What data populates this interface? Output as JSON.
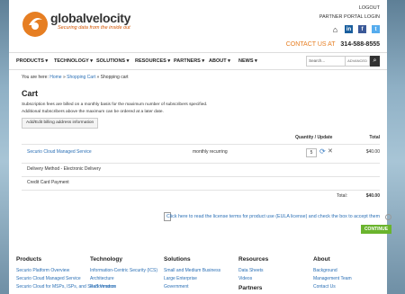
{
  "header": {
    "brand": "globalvelocity",
    "tagline": "Securing data from the inside out",
    "logout": "LOGOUT",
    "partner_login": "PARTNER PORTAL LOGIN",
    "contact_label": "CONTACT US AT",
    "phone": "314-588-8555"
  },
  "social": [
    "home-icon",
    "linkedin-icon",
    "facebook-icon",
    "twitter-icon"
  ],
  "nav": {
    "items": [
      "PRODUCTS",
      "TECHNOLOGY",
      "SOLUTIONS",
      "RESOURCES",
      "PARTNERS",
      "ABOUT",
      "NEWS"
    ],
    "search_placeholder": "Search...",
    "advanced": "ADVANCED",
    "search_icon": "search-icon"
  },
  "breadcrumb": {
    "prefix": "You are here:",
    "home": "Home",
    "sep": "»",
    "cart": "Shopping Cart",
    "current": "Shopping cart"
  },
  "cart": {
    "title": "Cart",
    "note1": "Subscription fees are billed on a monthly basis for the maximum number of subscribers specified.",
    "note2": "Additional Subscribers above the maximum can be ordered at a later date.",
    "edit_button": "Add/Edit billing address information",
    "col_qty": "Quantity / Update",
    "col_total": "Total",
    "product": "Securio Cloud Managed Service",
    "billing": "monthly recurring",
    "quantity": "5",
    "line_total": "$40.00",
    "delivery": "Delivery Method - Electronic Delivery",
    "payment": "Credit Card Payment",
    "total_label": "Total:",
    "total_value": "$40.00",
    "terms": "Click here to read the license terms for product use (EULA license) and check the box to accept them",
    "continue": "CONTINUE"
  },
  "footer": {
    "products": {
      "title": "Products",
      "links": [
        "Securio Platform Overview",
        "Securio Cloud Managed Service",
        "Securio Cloud for MSPs, ISPs, and SaaS Vendors"
      ]
    },
    "technology": {
      "title": "Technology",
      "links": [
        "Information-Centric Security (ICS)",
        "Architecture",
        "Performance"
      ]
    },
    "solutions": {
      "title": "Solutions",
      "links": [
        "Small and Medium Business",
        "Large Enterprise",
        "Government"
      ]
    },
    "resources": {
      "title": "Resources",
      "links": [
        "Data Sheets",
        "Videos"
      ],
      "partners_title": "Partners"
    },
    "about": {
      "title": "About",
      "links": [
        "Background",
        "Management Team",
        "Contact Us"
      ]
    }
  },
  "colors": {
    "accent": "#e67e22",
    "link": "#2a6fb5",
    "continue": "#6ab42d"
  }
}
